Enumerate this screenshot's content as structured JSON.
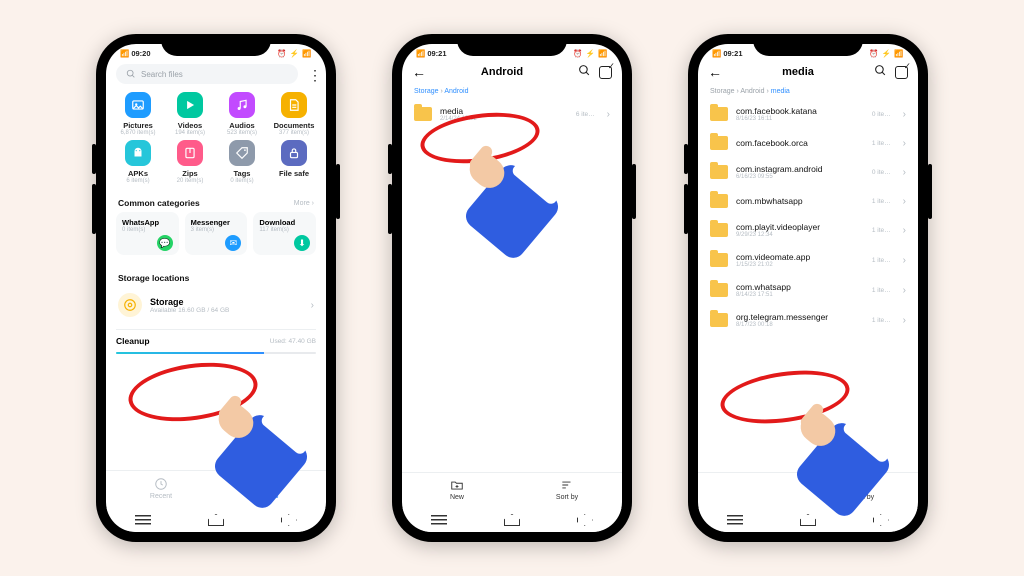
{
  "status": {
    "time": "09:20",
    "time2": "09:21",
    "time3": "09:21",
    "right": "⏰ ⚡ 📶"
  },
  "s1": {
    "search_placeholder": "Search files",
    "cats": [
      {
        "name": "Pictures",
        "sub": "6,870 item(s)",
        "color": "#1e9cff",
        "glyph": "img"
      },
      {
        "name": "Videos",
        "sub": "194 item(s)",
        "color": "#00c8a0",
        "glyph": "play"
      },
      {
        "name": "Audios",
        "sub": "523 item(s)",
        "color": "#c24bff",
        "glyph": "note"
      },
      {
        "name": "Documents",
        "sub": "377 item(s)",
        "color": "#f6b100",
        "glyph": "doc"
      },
      {
        "name": "APKs",
        "sub": "6 item(s)",
        "color": "#26c6da",
        "glyph": "apk"
      },
      {
        "name": "Zips",
        "sub": "20 item(s)",
        "color": "#ff5b8a",
        "glyph": "zip"
      },
      {
        "name": "Tags",
        "sub": "0 item(s)",
        "color": "#8e9aab",
        "glyph": "tag"
      },
      {
        "name": "File safe",
        "sub": "",
        "color": "#5c6bc0",
        "glyph": "lock"
      }
    ],
    "common_title": "Common categories",
    "more": "More ›",
    "common": [
      {
        "name": "WhatsApp",
        "sub": "0 item(s)",
        "color": "#25d366"
      },
      {
        "name": "Messenger",
        "sub": "3 item(s)",
        "color": "#1e9cff"
      },
      {
        "name": "Download",
        "sub": "117 item(s)",
        "color": "#00c8a0"
      }
    ],
    "storage_title": "Storage locations",
    "storage": {
      "name": "Storage",
      "sub": "Available 16.60 GB / 64 GB"
    },
    "cleanup": {
      "name": "Cleanup",
      "used": "Used: 47.40 GB"
    },
    "tabs": {
      "recent": "Recent",
      "files": "Files"
    }
  },
  "s2": {
    "title": "Android",
    "bc": [
      "Storage",
      "Android"
    ],
    "item": {
      "name": "media",
      "sub": "2/14/24 13:02",
      "cnt": "6  ite…"
    },
    "actions": {
      "new": "New",
      "sort": "Sort by"
    }
  },
  "s3": {
    "title": "media",
    "bc": [
      "Storage",
      "Android",
      "media"
    ],
    "items": [
      {
        "name": "com.facebook.katana",
        "sub": "8/16/23 16:11",
        "cnt": "0  ite…"
      },
      {
        "name": "com.facebook.orca",
        "sub": "",
        "cnt": "1  ite…"
      },
      {
        "name": "com.instagram.android",
        "sub": "6/16/23 09:55",
        "cnt": "0  ite…"
      },
      {
        "name": "com.mbwhatsapp",
        "sub": "",
        "cnt": "1  ite…"
      },
      {
        "name": "com.playit.videoplayer",
        "sub": "9/29/23 12:34",
        "cnt": "1  ite…"
      },
      {
        "name": "com.videomate.app",
        "sub": "1/15/23 21:02",
        "cnt": "1  ite…"
      },
      {
        "name": "com.whatsapp",
        "sub": "8/14/23 17:51",
        "cnt": "1  ite…"
      },
      {
        "name": "org.telegram.messenger",
        "sub": "8/17/23 00:18",
        "cnt": "1  ite…"
      }
    ],
    "sort": "Sort by"
  }
}
